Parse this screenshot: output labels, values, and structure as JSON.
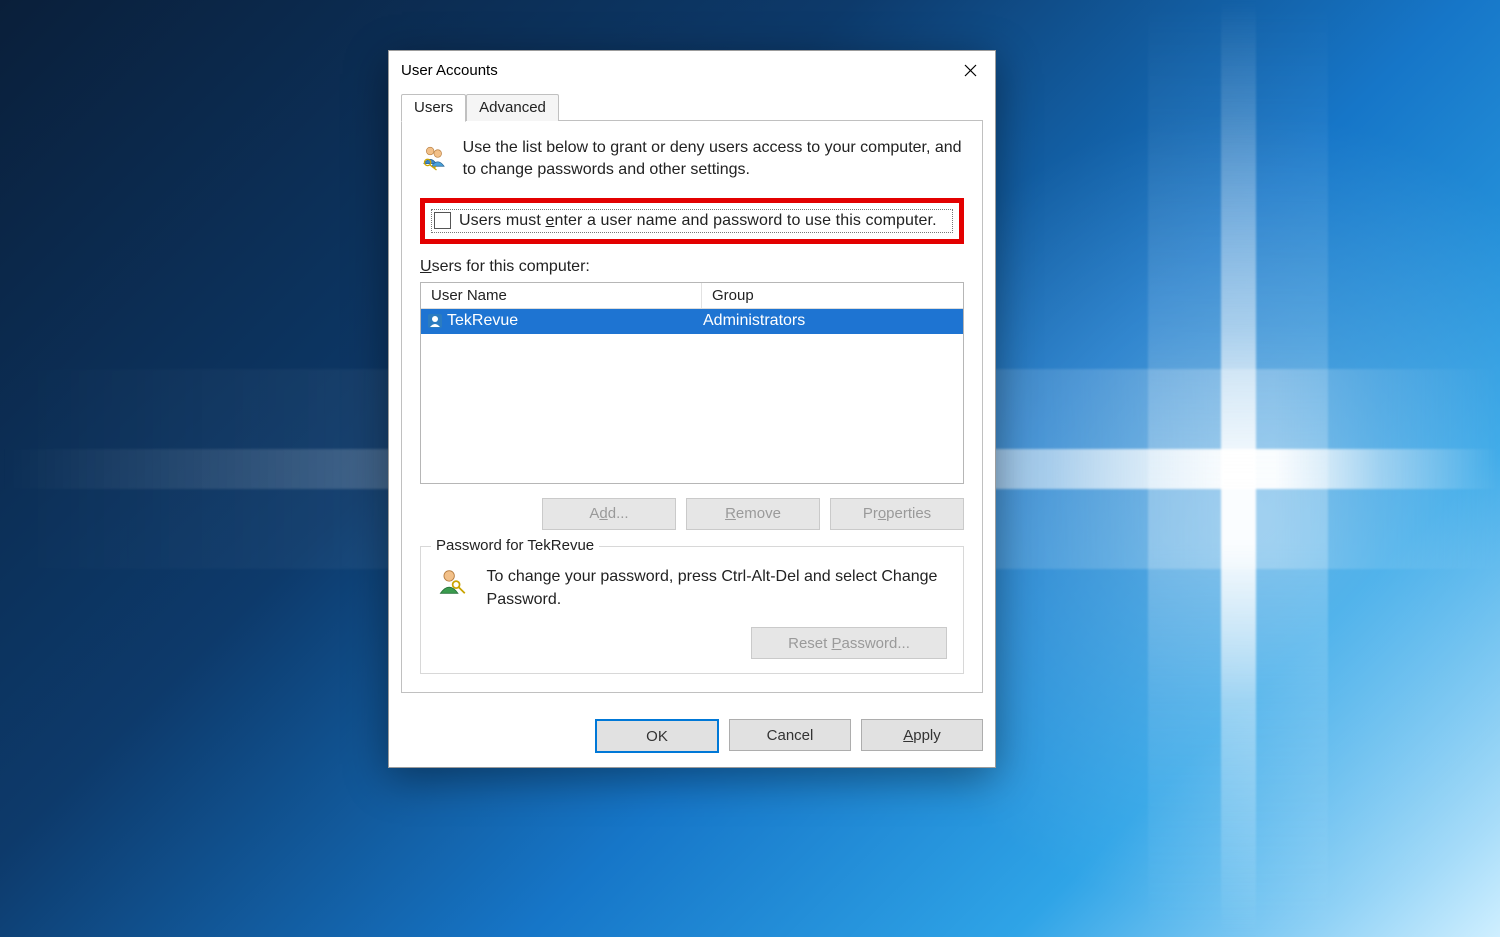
{
  "dialog": {
    "title": "User Accounts",
    "tabs": {
      "users": "Users",
      "advanced": "Advanced"
    },
    "intro_text": "Use the list below to grant or deny users access to your computer, and to change passwords and other settings.",
    "checkbox_label_pre": "Users must ",
    "checkbox_label_u": "e",
    "checkbox_label_post": "nter a user name and password to use this computer.",
    "users_label_pre": "",
    "users_label_u": "U",
    "users_label_post": "sers for this computer:",
    "listview": {
      "headers": {
        "user": "User Name",
        "group": "Group"
      },
      "rows": [
        {
          "user": "TekRevue",
          "group": "Administrators",
          "selected": true
        }
      ]
    },
    "buttons": {
      "add_pre": "A",
      "add_u": "d",
      "add_post": "d...",
      "remove_pre": "",
      "remove_u": "R",
      "remove_post": "emove",
      "props_pre": "Pr",
      "props_u": "o",
      "props_post": "perties"
    },
    "groupbox": {
      "legend": "Password for TekRevue",
      "text": "To change your password, press Ctrl-Alt-Del and select Change Password.",
      "reset_pre": "Reset ",
      "reset_u": "P",
      "reset_post": "assword..."
    }
  },
  "footer": {
    "ok": "OK",
    "cancel": "Cancel",
    "apply_pre": "",
    "apply_u": "A",
    "apply_post": "pply"
  }
}
